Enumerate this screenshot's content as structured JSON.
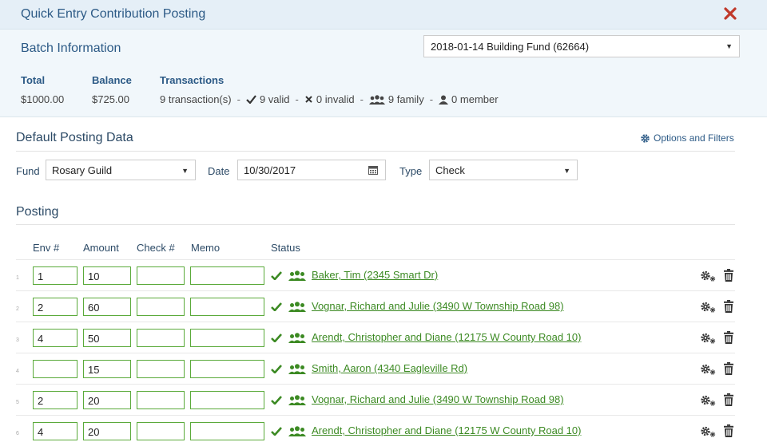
{
  "dialog": {
    "title": "Quick Entry Contribution Posting",
    "close_icon": "close-x-icon"
  },
  "batch": {
    "heading": "Batch Information",
    "selected": "2018-01-14 Building Fund (62664)",
    "total_label": "Total",
    "total_value": "$1000.00",
    "balance_label": "Balance",
    "balance_value": "$725.00",
    "transactions_label": "Transactions",
    "transactions": {
      "count_text": "9 transaction(s)",
      "valid_text": "9 valid",
      "invalid_text": "0 invalid",
      "family_text": "9 family",
      "member_text": "0 member",
      "separator": "-"
    }
  },
  "defaults": {
    "heading": "Default Posting Data",
    "options_label": "Options and Filters",
    "fund_label": "Fund",
    "fund_value": "Rosary Guild",
    "date_label": "Date",
    "date_value": "10/30/2017",
    "type_label": "Type",
    "type_value": "Check"
  },
  "posting": {
    "heading": "Posting",
    "columns": [
      "Env #",
      "Amount",
      "Check #",
      "Memo",
      "Status"
    ],
    "rows": [
      {
        "num": "1",
        "env": "1",
        "amount": "10",
        "check": "",
        "memo": "",
        "name": "Baker, Tim (2345 Smart Dr)"
      },
      {
        "num": "2",
        "env": "2",
        "amount": "60",
        "check": "",
        "memo": "",
        "name": "Vognar, Richard and Julie (3490 W Township Road 98)"
      },
      {
        "num": "3",
        "env": "4",
        "amount": "50",
        "check": "",
        "memo": "",
        "name": "Arendt, Christopher and Diane (12175 W County Road 10)"
      },
      {
        "num": "4",
        "env": "",
        "amount": "15",
        "check": "",
        "memo": "",
        "name": "Smith, Aaron (4340 Eagleville Rd)"
      },
      {
        "num": "5",
        "env": "2",
        "amount": "20",
        "check": "",
        "memo": "",
        "name": "Vognar, Richard and Julie (3490 W Township Road 98)"
      },
      {
        "num": "6",
        "env": "4",
        "amount": "20",
        "check": "",
        "memo": "",
        "name": "Arendt, Christopher and Diane (12175 W County Road 10)"
      }
    ]
  },
  "colors": {
    "heading": "#2c5a86",
    "valid": "#3c8a23",
    "close": "#c0392b",
    "header_bg": "#e5eff7",
    "batch_bg": "#f1f7fb"
  }
}
